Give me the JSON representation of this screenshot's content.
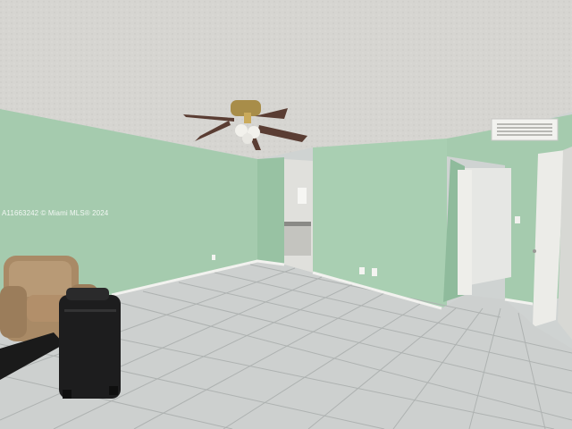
{
  "photo": {
    "watermark": "A11663242 © Miami MLS® 2024"
  },
  "colors": {
    "ceiling": "#d8d7d3",
    "wall_green": "#a7cdb0",
    "wall_green_shadow": "#8fbb9c",
    "floor_tile": "#cdd0cf",
    "baseboard": "#f2f2ef",
    "door": "#eeeeea",
    "fan": "#5a3d33"
  }
}
